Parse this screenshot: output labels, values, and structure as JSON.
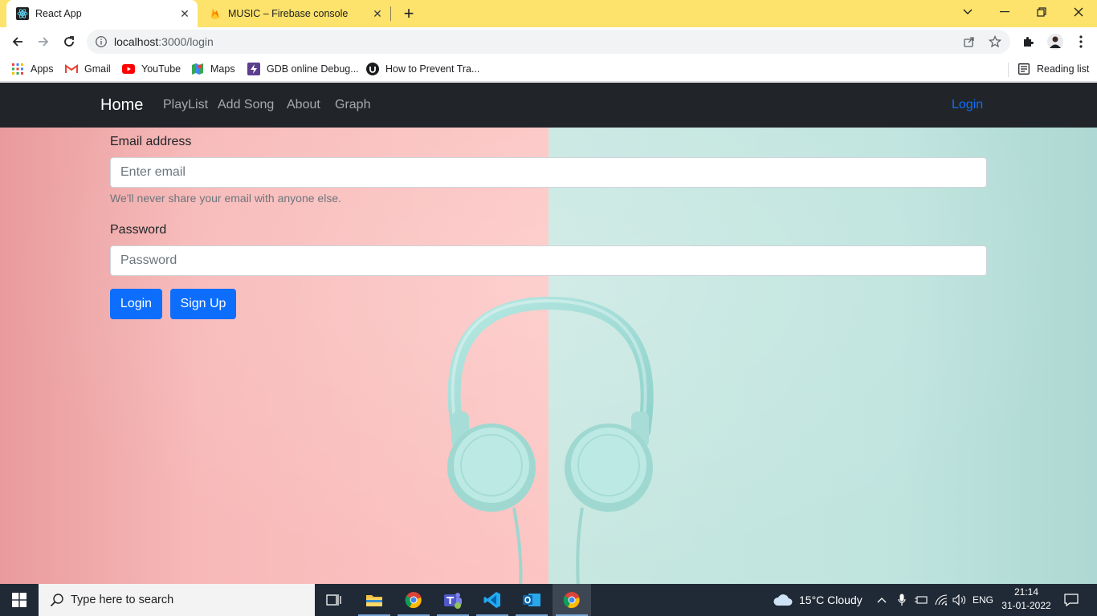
{
  "browser": {
    "tabs": [
      {
        "title": "React App",
        "icon": "react-icon",
        "active": true
      },
      {
        "title": "MUSIC – Firebase console",
        "icon": "firebase-icon",
        "active": false
      }
    ],
    "url_host": "localhost",
    "url_path": ":3000/login",
    "bookmarks": [
      {
        "label": "Apps",
        "icon": "apps-grid-icon"
      },
      {
        "label": "Gmail",
        "icon": "gmail-icon"
      },
      {
        "label": "YouTube",
        "icon": "youtube-icon"
      },
      {
        "label": "Maps",
        "icon": "maps-icon"
      },
      {
        "label": "GDB online Debug...",
        "icon": "gdb-icon"
      },
      {
        "label": "How to Prevent Tra...",
        "icon": "udemy-icon"
      }
    ],
    "reading_list": "Reading list"
  },
  "navbar": {
    "brand": "Home",
    "links": [
      "PlayList",
      "Add Song",
      "About",
      "Graph"
    ],
    "login": "Login",
    "login_color": "#0d6efd"
  },
  "form": {
    "email_label": "Email address",
    "email_placeholder": "Enter email",
    "email_help": "We'll never share your email with anyone else.",
    "password_label": "Password",
    "password_placeholder": "Password",
    "login_button": "Login",
    "signup_button": "Sign Up",
    "button_color": "#0d6efd"
  },
  "taskbar": {
    "search_placeholder": "Type here to search",
    "apps": [
      "task-view-icon",
      "file-explorer-icon",
      "chrome-icon",
      "teams-icon",
      "vscode-icon",
      "outlook-icon",
      "chrome-icon"
    ],
    "weather": "15°C  Cloudy",
    "language": "ENG",
    "time": "21:14",
    "date": "31-01-2022"
  }
}
